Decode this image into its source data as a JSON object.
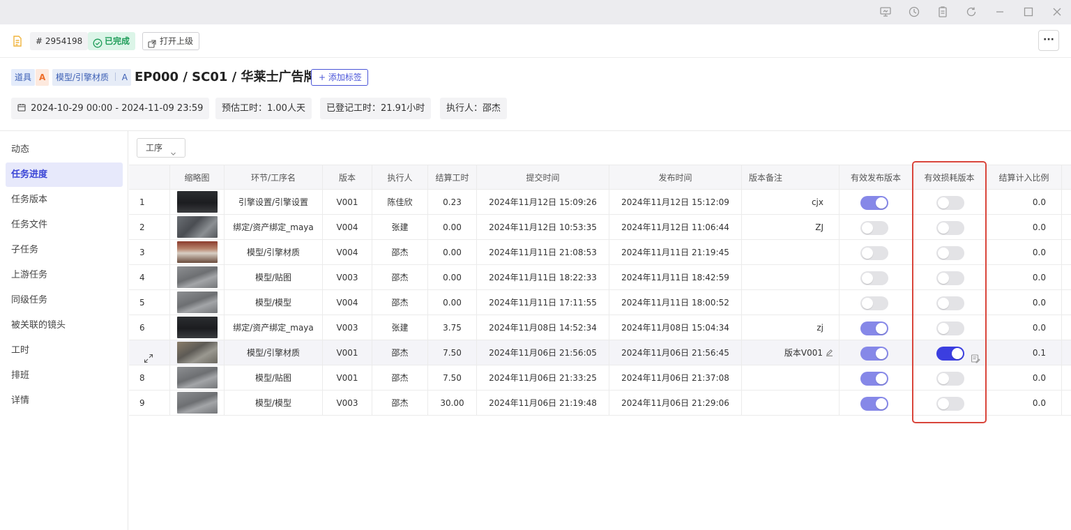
{
  "header": {
    "task_id": "# 2954198",
    "status": "已完成",
    "open_parent": "打开上级",
    "more": "···"
  },
  "title": {
    "tag1": "道具",
    "tag1_grade": "A",
    "tag2": "模型/引擎材质",
    "tag2_grade": "A",
    "text": "EP000 / SC01 / 华莱士广告牌",
    "add_tag": "+ 添加标签"
  },
  "info": {
    "date_range": "2024-10-29 00:00 - 2024-11-09 23:59",
    "estimate": "预估工时：1.00人天",
    "logged": "已登记工时：21.91小时",
    "assignee": "执行人：邵杰"
  },
  "sidebar": {
    "items": [
      {
        "label": "动态"
      },
      {
        "label": "任务进度"
      },
      {
        "label": "任务版本"
      },
      {
        "label": "任务文件"
      },
      {
        "label": "子任务"
      },
      {
        "label": "上游任务"
      },
      {
        "label": "同级任务"
      },
      {
        "label": "被关联的镜头"
      },
      {
        "label": "工时"
      },
      {
        "label": "排班"
      },
      {
        "label": "详情"
      }
    ]
  },
  "filter": {
    "label": "工序"
  },
  "table": {
    "columns": [
      "",
      "缩略图",
      "环节/工序名",
      "版本",
      "执行人",
      "结算工时",
      "提交时间",
      "发布时间",
      "版本备注",
      "有效发布版本",
      "有效损耗版本",
      "结算计入比例"
    ],
    "rows": [
      {
        "no": "1",
        "thumb": "dark",
        "process": "引擎设置/引擎设置",
        "version": "V001",
        "assignee": "陈佳欣",
        "hours": "0.23",
        "submit": "2024年11月12日 15:09:26",
        "publish": "2024年11月12日 15:12:09",
        "note": "cjx",
        "valid_publish": true,
        "valid_loss": false,
        "ratio": "0.0"
      },
      {
        "no": "2",
        "thumb": "scene",
        "process": "绑定/资产绑定_maya",
        "version": "V004",
        "assignee": "张建",
        "hours": "0.00",
        "submit": "2024年11月12日 10:53:35",
        "publish": "2024年11月12日 11:06:44",
        "note": "ZJ",
        "valid_publish": false,
        "valid_loss": false,
        "ratio": "0.0"
      },
      {
        "no": "3",
        "thumb": "red",
        "process": "模型/引擎材质",
        "version": "V004",
        "assignee": "邵杰",
        "hours": "0.00",
        "submit": "2024年11月11日 21:08:53",
        "publish": "2024年11月11日 21:19:45",
        "note": "",
        "valid_publish": false,
        "valid_loss": false,
        "ratio": "0.0"
      },
      {
        "no": "4",
        "thumb": "gray",
        "process": "模型/贴图",
        "version": "V003",
        "assignee": "邵杰",
        "hours": "0.00",
        "submit": "2024年11月11日 18:22:33",
        "publish": "2024年11月11日 18:42:59",
        "note": "",
        "valid_publish": false,
        "valid_loss": false,
        "ratio": "0.0"
      },
      {
        "no": "5",
        "thumb": "gray",
        "process": "模型/模型",
        "version": "V004",
        "assignee": "邵杰",
        "hours": "0.00",
        "submit": "2024年11月11日 17:11:55",
        "publish": "2024年11月11日 18:00:52",
        "note": "",
        "valid_publish": false,
        "valid_loss": false,
        "ratio": "0.0"
      },
      {
        "no": "6",
        "thumb": "dark",
        "process": "绑定/资产绑定_maya",
        "version": "V003",
        "assignee": "张建",
        "hours": "3.75",
        "submit": "2024年11月08日 14:52:34",
        "publish": "2024年11月08日 15:04:34",
        "note": "zj",
        "valid_publish": true,
        "valid_loss": false,
        "ratio": "0.0"
      },
      {
        "no": "",
        "thumb": "mix",
        "process": "模型/引擎材质",
        "version": "V001",
        "assignee": "邵杰",
        "hours": "7.50",
        "submit": "2024年11月06日 21:56:05",
        "publish": "2024年11月06日 21:56:45",
        "note": "版本V001",
        "valid_publish": true,
        "valid_loss": true,
        "ratio": "0.1"
      },
      {
        "no": "8",
        "thumb": "gray",
        "process": "模型/贴图",
        "version": "V001",
        "assignee": "邵杰",
        "hours": "7.50",
        "submit": "2024年11月06日 21:33:25",
        "publish": "2024年11月06日 21:37:08",
        "note": "",
        "valid_publish": true,
        "valid_loss": false,
        "ratio": "0.0"
      },
      {
        "no": "9",
        "thumb": "gray",
        "process": "模型/模型",
        "version": "V003",
        "assignee": "邵杰",
        "hours": "30.00",
        "submit": "2024年11月06日 21:19:48",
        "publish": "2024年11月06日 21:29:06",
        "note": "",
        "valid_publish": true,
        "valid_loss": false,
        "ratio": "0.0"
      }
    ]
  },
  "colors": {
    "accent": "#3b46d6",
    "toggle_on": "#8688e8",
    "toggle_on_active": "#3b3ee0",
    "highlight_border": "#d9453b",
    "status_green": "#1f9d59"
  },
  "icons": {
    "titlebar": [
      "screen-icon",
      "history-icon",
      "clipboard-icon",
      "refresh-icon",
      "minimize-icon",
      "maximize-icon",
      "close-icon"
    ],
    "doc": "document-icon"
  }
}
